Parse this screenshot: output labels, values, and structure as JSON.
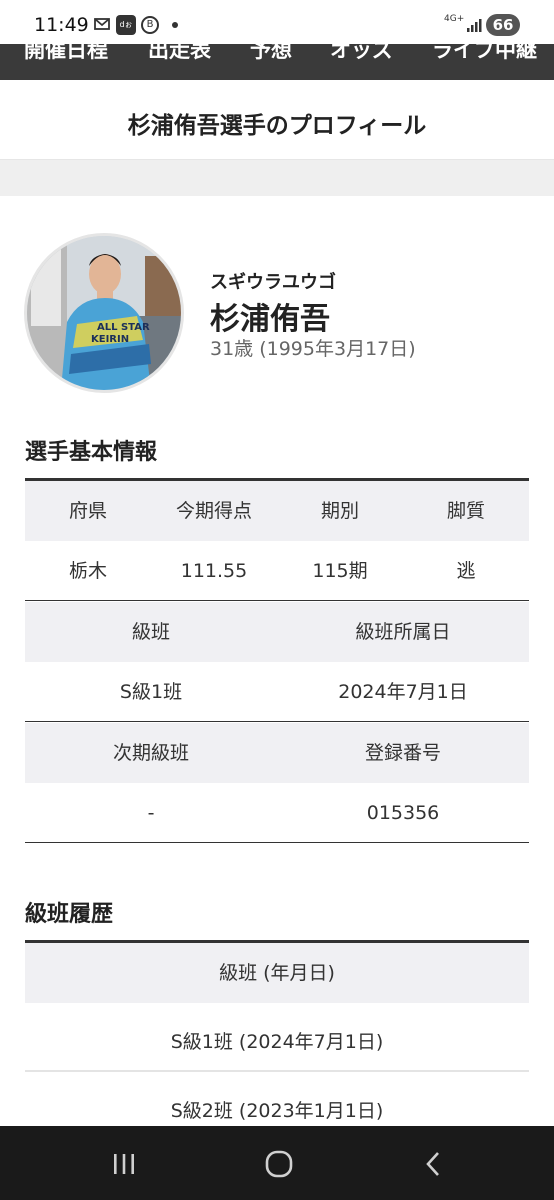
{
  "status_bar": {
    "time": "11:49",
    "d_icon_text": "dぉ",
    "network": "4G+",
    "battery": "66",
    "icons": [
      "mail-icon",
      "d-app-icon",
      "b-app-icon",
      "notification-dot-icon",
      "signal-icon"
    ]
  },
  "top_nav": {
    "items": [
      "開催日程",
      "出走表",
      "予想",
      "オッズ",
      "ライブ中継"
    ]
  },
  "page": {
    "title": "杉浦侑吾選手のプロフィール"
  },
  "profile": {
    "kana": "スギウラユウゴ",
    "name": "杉浦侑吾",
    "age": "31歳 (1995年3月17日)",
    "jersey_text": "ALL STAR KEIRIN"
  },
  "basic_info": {
    "heading": "選手基本情報",
    "row1_headers": [
      "府県",
      "今期得点",
      "期別",
      "脚質"
    ],
    "row1_values": [
      "栃木",
      "111.55",
      "115期",
      "逃"
    ],
    "row2_headers": [
      "級班",
      "級班所属日"
    ],
    "row2_values": [
      "S級1班",
      "2024年7月1日"
    ],
    "row3_headers": [
      "次期級班",
      "登録番号"
    ],
    "row3_values": [
      "-",
      "015356"
    ]
  },
  "class_history": {
    "heading": "級班履歴",
    "header": "級班 (年月日)",
    "rows": [
      "S級1班 (2024年7月1日)",
      "S級2班 (2023年1月1日)"
    ]
  },
  "nav_bar": {
    "buttons": [
      "recent-apps-icon",
      "home-icon",
      "back-icon"
    ]
  }
}
